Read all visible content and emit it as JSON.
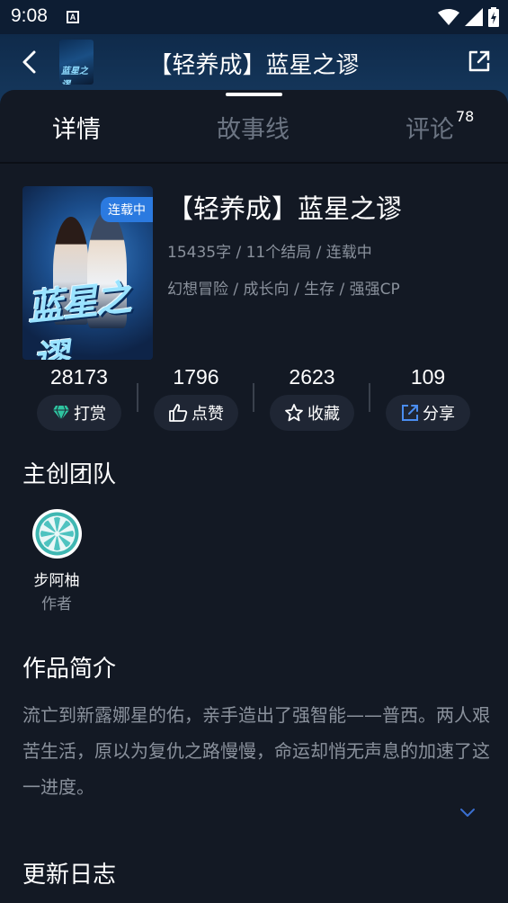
{
  "status": {
    "time": "9:08",
    "a_icon": "A"
  },
  "header": {
    "title": "【轻养成】蓝星之谬",
    "thumb_text": "蓝星之谬"
  },
  "tabs": [
    {
      "label": "详情",
      "active": true
    },
    {
      "label": "故事线",
      "active": false
    },
    {
      "label": "评论",
      "active": false,
      "count": "78"
    }
  ],
  "book": {
    "badge": "连载中",
    "cover_text": "蓝星之谬",
    "title": "【轻养成】蓝星之谬",
    "meta": "15435字 / 11个结局 / 连载中",
    "tags": "幻想冒险 / 成长向 / 生存 / 强强CP"
  },
  "stats": [
    {
      "value": "28173",
      "label": "打赏",
      "icon": "diamond-icon"
    },
    {
      "value": "1796",
      "label": "点赞",
      "icon": "thumbs-up-icon"
    },
    {
      "value": "2623",
      "label": "收藏",
      "icon": "star-icon"
    },
    {
      "value": "109",
      "label": "分享",
      "icon": "share-icon"
    }
  ],
  "team": {
    "title": "主创团队",
    "creator": {
      "name": "步阿柚",
      "role": "作者"
    }
  },
  "intro": {
    "title": "作品简介",
    "text": "流亡到新露娜星的佑，亲手造出了强智能——普西。两人艰苦生活，原以为复仇之路慢慢，命运却悄无声息的加速了这一进度。"
  },
  "changelog": {
    "title": "更新日志"
  },
  "colors": {
    "accent": "#2b7ae0",
    "diamond": "#2ec4a0",
    "background": "#131924"
  }
}
